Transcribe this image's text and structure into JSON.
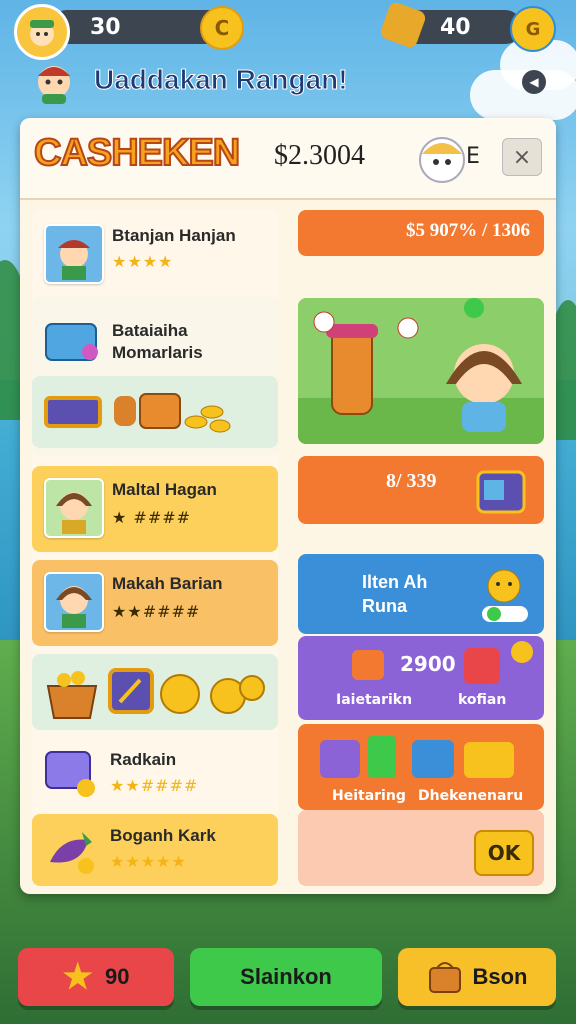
{
  "topbar": {
    "coins": "30",
    "coin_badge": "C",
    "gems": "40",
    "gem_badge": "G"
  },
  "title": "Uaddakan Rangan!",
  "header": {
    "brand": "CASHEKEN",
    "money": "$2.3004",
    "extra": "E",
    "close": "×"
  },
  "left_list": [
    {
      "title": "Btanjan Hanjan",
      "rating": "★★★★"
    },
    {
      "title": "Bataiaiha Momarlaris"
    },
    {
      "title": "Maltal Hagan",
      "rating": "★ ####"
    },
    {
      "title": "Makah Barian",
      "rating": "★★####"
    },
    {
      "title": "Radkain",
      "rating": "★★####"
    },
    {
      "title": "Boganh Kark",
      "rating": "★★★★★"
    }
  ],
  "right_panel": {
    "price_banner": "$5 907% / 1306",
    "offer_price": "8/ 339",
    "info_title": "Ilten Ah Runa",
    "bundle_price": "2900",
    "bundle_left": "Iaietarikn",
    "bundle_right": "kofian",
    "items_left": "Heitaring",
    "items_right": "Dhekenenaru",
    "ok": "OK"
  },
  "footer": {
    "stars_count": "90",
    "middle": "Slainkon",
    "right": "Bson"
  },
  "colors": {
    "accent_orange": "#f2792f",
    "green_button": "#3fc94a",
    "red_button": "#e9464a",
    "yellow_button": "#f7bf28"
  }
}
